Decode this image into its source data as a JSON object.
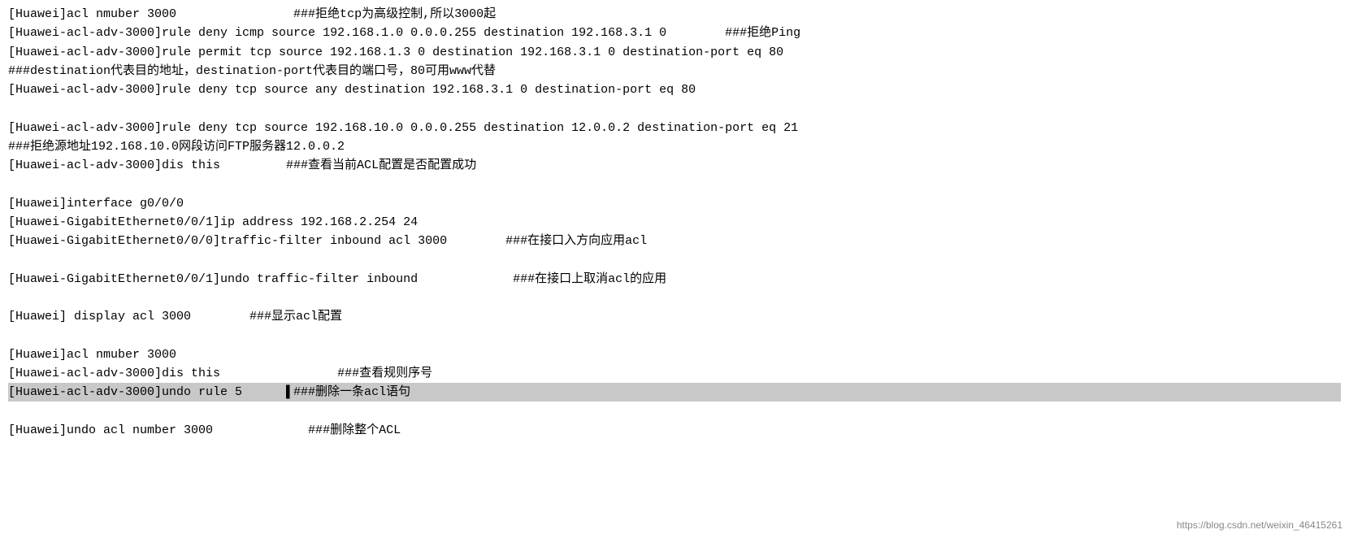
{
  "terminal": {
    "lines": [
      {
        "id": "l1",
        "text": "[Huawei]acl nmuber 3000                ###拒绝tcp为高级控制,所以3000起",
        "highlight": false
      },
      {
        "id": "l2",
        "text": "[Huawei-acl-adv-3000]rule deny icmp source 192.168.1.0 0.0.0.255 destination 192.168.3.1 0        ###拒绝Ping",
        "highlight": false
      },
      {
        "id": "l3",
        "text": "[Huawei-acl-adv-3000]rule permit tcp source 192.168.1.3 0 destination 192.168.3.1 0 destination-port eq 80",
        "highlight": false
      },
      {
        "id": "l4",
        "text": "###destination代表目的地址，destination-port代表目的端口号，80可用www代替",
        "highlight": false
      },
      {
        "id": "l5",
        "text": "[Huawei-acl-adv-3000]rule deny tcp source any destination 192.168.3.1 0 destination-port eq 80",
        "highlight": false
      },
      {
        "id": "l6",
        "text": "",
        "highlight": false,
        "empty": true
      },
      {
        "id": "l7",
        "text": "[Huawei-acl-adv-3000]rule deny tcp source 192.168.10.0 0.0.0.255 destination 12.0.0.2 destination-port eq 21",
        "highlight": false
      },
      {
        "id": "l8",
        "text": "###拒绝源地址192.168.10.0网段访问FTP服务器12.0.0.2",
        "highlight": false
      },
      {
        "id": "l9",
        "text": "[Huawei-acl-adv-3000]dis this         ###查看当前ACL配置是否配置成功",
        "highlight": false
      },
      {
        "id": "l10",
        "text": "",
        "highlight": false,
        "empty": true
      },
      {
        "id": "l11",
        "text": "[Huawei]interface g0/0/0",
        "highlight": false
      },
      {
        "id": "l12",
        "text": "[Huawei-GigabitEthernet0/0/1]ip address 192.168.2.254 24",
        "highlight": false
      },
      {
        "id": "l13",
        "text": "[Huawei-GigabitEthernet0/0/0]traffic-filter inbound acl 3000        ###在接口入方向应用acl",
        "highlight": false
      },
      {
        "id": "l14",
        "text": "",
        "highlight": false,
        "empty": true
      },
      {
        "id": "l15",
        "text": "[Huawei-GigabitEthernet0/0/1]undo traffic-filter inbound             ###在接口上取消acl的应用",
        "highlight": false
      },
      {
        "id": "l16",
        "text": "",
        "highlight": false,
        "empty": true
      },
      {
        "id": "l17",
        "text": "[Huawei] display acl 3000        ###显示acl配置",
        "highlight": false
      },
      {
        "id": "l18",
        "text": "",
        "highlight": false,
        "empty": true
      },
      {
        "id": "l19",
        "text": "[Huawei]acl nmuber 3000",
        "highlight": false
      },
      {
        "id": "l20",
        "text": "[Huawei-acl-adv-3000]dis this                ###查看规则序号",
        "highlight": false
      },
      {
        "id": "l21",
        "text": "[Huawei-acl-adv-3000]undo rule 5      ▌###删除一条acl语句",
        "highlight": true
      },
      {
        "id": "l22",
        "text": "",
        "highlight": false,
        "empty": true
      },
      {
        "id": "l23",
        "text": "[Huawei]undo acl number 3000             ###删除整个ACL",
        "highlight": false
      }
    ],
    "watermark": "https://blog.csdn.net/weixin_46415261"
  }
}
